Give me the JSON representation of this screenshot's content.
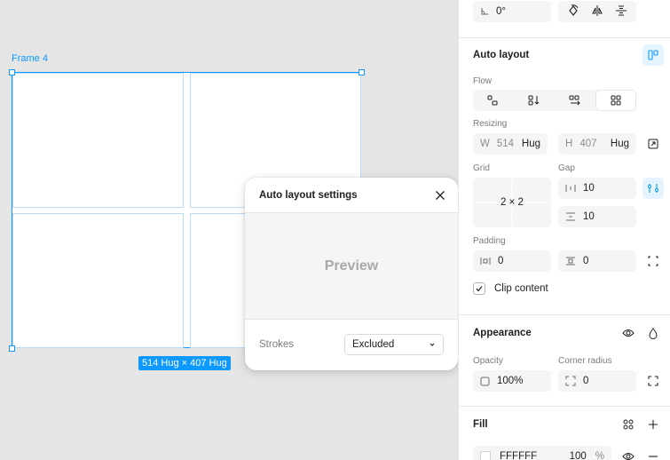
{
  "canvas": {
    "frame_label": "Frame 4",
    "size_badge": "514 Hug × 407 Hug"
  },
  "popover": {
    "title": "Auto layout settings",
    "preview_text": "Preview",
    "strokes_label": "Strokes",
    "strokes_value": "Excluded"
  },
  "panel": {
    "rotation": "0°",
    "auto_layout": {
      "title": "Auto layout",
      "flow_label": "Flow",
      "resizing_label": "Resizing",
      "width_prefix": "W",
      "width_value": "514",
      "width_mode": "Hug",
      "height_prefix": "H",
      "height_value": "407",
      "height_mode": "Hug",
      "grid_label": "Grid",
      "grid_value": "2 × 2",
      "gap_label": "Gap",
      "gap_horizontal": "10",
      "gap_vertical": "10",
      "padding_label": "Padding",
      "padding_horizontal": "0",
      "padding_vertical": "0",
      "clip_content_label": "Clip content",
      "clip_content_checked": true
    },
    "appearance": {
      "title": "Appearance",
      "opacity_label": "Opacity",
      "opacity_value": "100%",
      "corner_radius_label": "Corner radius",
      "corner_radius_value": "0"
    },
    "fill": {
      "title": "Fill",
      "hex": "FFFFFF",
      "opacity": "100",
      "opacity_unit": "%",
      "color": "#FFFFFF"
    }
  },
  "colors": {
    "accent": "#0d99ff",
    "canvas_bg": "#e5e5e5"
  }
}
